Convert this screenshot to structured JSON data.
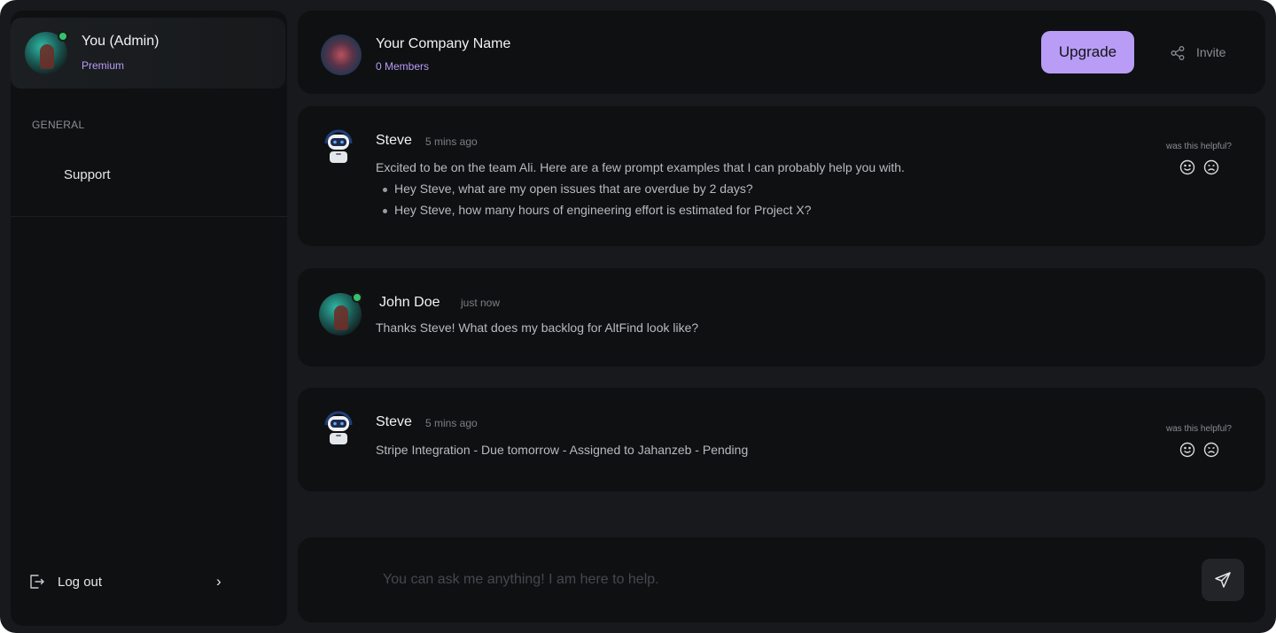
{
  "sidebar": {
    "profile": {
      "name": "You (Admin)",
      "plan": "Premium",
      "status": "online"
    },
    "section_title": "GENERAL",
    "nav_items": [
      {
        "label": "Support"
      }
    ],
    "logout_label": "Log out"
  },
  "header": {
    "company_name": "Your Company Name",
    "members": "0 Members",
    "upgrade_label": "Upgrade",
    "invite_label": "Invite"
  },
  "messages": [
    {
      "sender": "Steve",
      "time": "5 mins ago",
      "text": "Excited to be on the team Ali. Here are a few prompt examples that I can probably help you with.",
      "bullets": [
        "Hey Steve,  what are my open issues that are overdue by 2 days?",
        "Hey Steve, how many hours of engineering effort is estimated for Project X?"
      ],
      "helpful_label": "was this helpful?"
    },
    {
      "sender": "John Doe",
      "time": "just now",
      "text": "Thanks Steve! What does my backlog for AltFind  look like?"
    },
    {
      "sender": "Steve",
      "time": "5 mins ago",
      "text": "Stripe Integration  - Due tomorrow - Assigned to Jahanzeb - Pending",
      "helpful_label": "was this helpful?"
    }
  ],
  "composer": {
    "placeholder": "You can ask me anything! I am here to help.",
    "value": ""
  },
  "colors": {
    "accent": "#b89cf6",
    "online": "#33c46a",
    "background": "#17191c",
    "panel": "#0f1012"
  }
}
